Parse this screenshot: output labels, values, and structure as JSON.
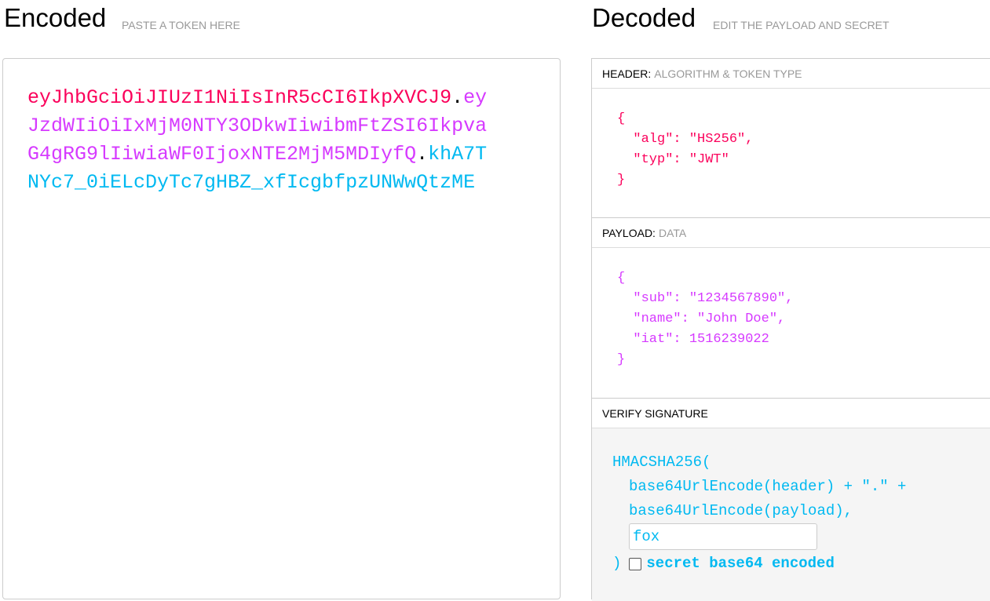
{
  "colors": {
    "header": "#fb015b",
    "payload": "#d63aff",
    "signature": "#00b9f1"
  },
  "encoded": {
    "title": "Encoded",
    "subtitle": "PASTE A TOKEN HERE",
    "token_header": "eyJhbGciOiJIUzI1NiIsInR5cCI6IkpXVCJ9",
    "token_payload": "eyJzdWIiOiIxMjM0NTY3ODkwIiwibmFtZSI6IkpvaG4gRG9lIiwiaWF0IjoxNTE2MjM5MDIyfQ",
    "token_signature": "khA7TNYc7_0iELcDyTc7gHBZ_xfIcgbfpzUNWwQtzME",
    "dot": "."
  },
  "decoded": {
    "title": "Decoded",
    "subtitle": "EDIT THE PAYLOAD AND SECRET",
    "header_label": "HEADER:",
    "header_sublabel": "ALGORITHM & TOKEN TYPE",
    "header_json": "{\n  \"alg\": \"HS256\",\n  \"typ\": \"JWT\"\n}",
    "payload_label": "PAYLOAD:",
    "payload_sublabel": "DATA",
    "payload_json": "{\n  \"sub\": \"1234567890\",\n  \"name\": \"John Doe\",\n  \"iat\": 1516239022\n}",
    "verify_label": "VERIFY SIGNATURE",
    "verify": {
      "line1": "HMACSHA256(",
      "line2": "base64UrlEncode(header) + \".\" +",
      "line3": "base64UrlEncode(payload),",
      "secret": "fox",
      "close": ")",
      "checkbox_label": "secret base64 encoded",
      "checked": false
    }
  }
}
